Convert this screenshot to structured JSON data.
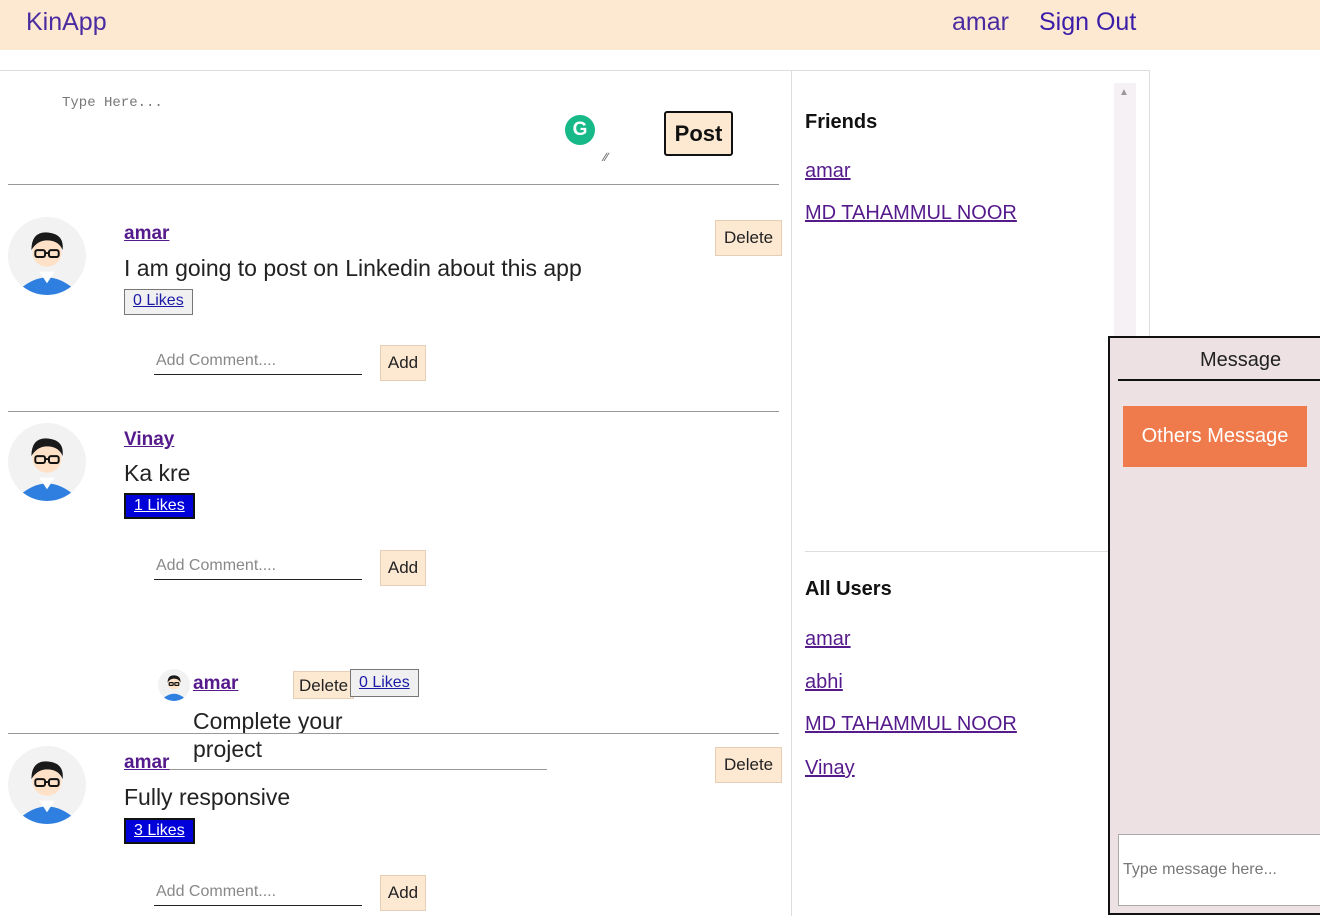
{
  "navbar": {
    "brand": "KinApp",
    "user": "amar",
    "sign_out": "Sign Out"
  },
  "composer": {
    "placeholder": "Type Here...",
    "post_label": "Post",
    "grammarly_icon": "G"
  },
  "posts": [
    {
      "author": "amar",
      "text": "I am going to post on Linkedin about this app",
      "likes": "0 Likes",
      "delete_label": "Delete",
      "comment_placeholder": "Add Comment....",
      "add_label": "Add"
    },
    {
      "author": "Vinay",
      "text": "Ka kre",
      "likes": "1 Likes",
      "comment_placeholder": "Add Comment....",
      "add_label": "Add",
      "comments": [
        {
          "author": "amar",
          "delete_label": "Delete",
          "likes": "0 Likes",
          "text": "Complete your project"
        }
      ]
    },
    {
      "author": "amar",
      "text": "Fully responsive",
      "likes": "3 Likes",
      "delete_label": "Delete",
      "comment_placeholder": "Add Comment....",
      "add_label": "Add"
    }
  ],
  "sidebar": {
    "friends_title": "Friends",
    "friends": [
      "amar",
      "MD TAHAMMUL NOOR"
    ],
    "all_users_title": "All Users",
    "all_users": [
      "amar",
      "abhi",
      "MD TAHAMMUL NOOR",
      "Vinay"
    ]
  },
  "message": {
    "title": "Message",
    "bubble": "Others Message",
    "input_placeholder": "Type message here..."
  },
  "colors": {
    "navbar_bg": "#fde8d2",
    "brand_text": "#4a2ca0",
    "like_active": "#0000d8",
    "message_bubble": "#ef7b4c",
    "message_panel": "#ede1e3"
  }
}
